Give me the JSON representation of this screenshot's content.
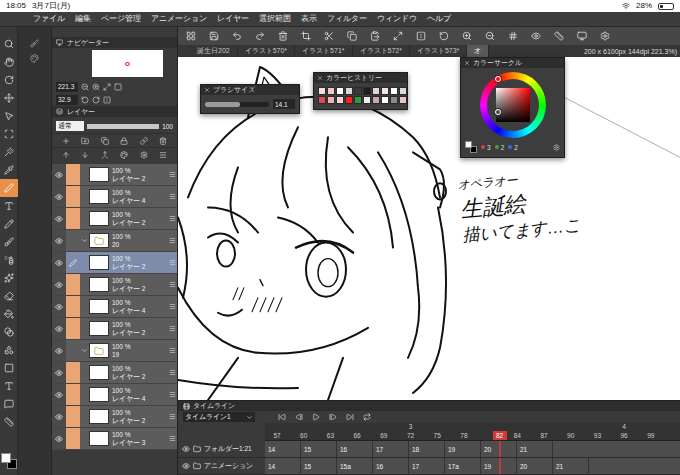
{
  "status_bar": {
    "time": "18:05",
    "date": "3月7日(月)",
    "battery": "28%",
    "battery_level": 0.28
  },
  "menu": [
    "ファイル",
    "編集",
    "ページ管理",
    "アニメーション",
    "レイヤー",
    "選択範囲",
    "表示",
    "フィルター",
    "ウィンドウ",
    "ヘルプ"
  ],
  "tools": [
    {
      "selected": false
    },
    {
      "selected": false
    },
    {
      "selected": false
    },
    {
      "selected": false
    },
    {
      "selected": false
    },
    {
      "selected": false
    },
    {
      "selected": false
    },
    {
      "selected": false
    },
    {
      "selected": true
    },
    {
      "selected": false
    },
    {
      "selected": false
    },
    {
      "selected": false
    },
    {
      "selected": false
    },
    {
      "selected": false
    },
    {
      "selected": false
    },
    {
      "selected": false
    },
    {
      "selected": false
    },
    {
      "selected": false
    },
    {
      "selected": false
    },
    {
      "selected": false
    },
    {
      "selected": false
    },
    {
      "selected": false
    }
  ],
  "colors": {
    "main": "#ffffff",
    "sub": "#000000"
  },
  "navigator": {
    "title": "ナビゲーター",
    "zoom": "221.3",
    "rotation": "32.9"
  },
  "layer_panel": {
    "title": "レイヤー",
    "blend_mode": "通常",
    "opacity": "100",
    "opacity_level": 1.0,
    "layers": [
      {
        "kind": "layer",
        "opacity": "100 %",
        "name": "レイヤー 2",
        "visible": true,
        "marked": true,
        "selected": false
      },
      {
        "kind": "layer",
        "opacity": "100 %",
        "name": "レイヤー 4",
        "visible": true,
        "marked": true,
        "selected": false
      },
      {
        "kind": "layer",
        "opacity": "100 %",
        "name": "レイヤー 2",
        "visible": true,
        "marked": true,
        "selected": false
      },
      {
        "kind": "folder",
        "opacity": "100 %",
        "name": "20",
        "visible": true,
        "marked": false,
        "selected": false,
        "expanded": true
      },
      {
        "kind": "layer",
        "opacity": "100 %",
        "name": "レイヤー 2",
        "visible": true,
        "marked": false,
        "selected": true
      },
      {
        "kind": "layer",
        "opacity": "100 %",
        "name": "レイヤー 2",
        "visible": true,
        "marked": true,
        "selected": false
      },
      {
        "kind": "layer",
        "opacity": "100 %",
        "name": "レイヤー 4",
        "visible": true,
        "marked": true,
        "selected": false
      },
      {
        "kind": "layer",
        "opacity": "100 %",
        "name": "レイヤー 2",
        "visible": true,
        "marked": true,
        "selected": false
      },
      {
        "kind": "folder",
        "opacity": "100 %",
        "name": "19",
        "visible": true,
        "marked": false,
        "selected": false,
        "expanded": true
      },
      {
        "kind": "layer",
        "opacity": "100 %",
        "name": "レイヤー 2",
        "visible": true,
        "marked": true,
        "selected": false
      },
      {
        "kind": "layer",
        "opacity": "100 %",
        "name": "レイヤー 4",
        "visible": true,
        "marked": true,
        "selected": false
      },
      {
        "kind": "layer",
        "opacity": "100 %",
        "name": "レイヤー 2",
        "visible": true,
        "marked": true,
        "selected": false
      },
      {
        "kind": "layer",
        "opacity": "100 %",
        "name": "レイヤー 3",
        "visible": true,
        "marked": true,
        "selected": false
      }
    ]
  },
  "document_tabs": [
    {
      "label": "誕生日202",
      "selected": false
    },
    {
      "label": "イラスト570*",
      "selected": false
    },
    {
      "label": "イラスト571*",
      "selected": false
    },
    {
      "label": "イラスト572*",
      "selected": false
    },
    {
      "label": "イラスト573*",
      "selected": false
    },
    {
      "label": "オ",
      "selected": true
    }
  ],
  "canvas_info": "200 x 6100px 144dpi 221.3%)",
  "canvas_note": [
    "オペラオー",
    "生誕絵",
    "描いてます…こ"
  ],
  "brush_size": {
    "title": "ブラシサイズ",
    "value": "14.1",
    "level": 0.55
  },
  "color_history": {
    "title": "カラーヒストリー",
    "swatches": [
      {
        "color": "#f6dede"
      },
      {
        "color": "#f1c6ca"
      },
      {
        "color": "#ffffff"
      },
      {
        "color": "#d9d9d9"
      },
      {
        "color": "#3a3a3a"
      },
      {
        "color": "#1e1e1e"
      },
      {
        "color": "#e6d2d2"
      },
      {
        "color": "#f4e3e3"
      },
      {
        "color": "#ffffff"
      },
      {
        "color": "#dcdcdc"
      },
      {
        "color": "#e24848"
      },
      {
        "color": "#f3b3b3"
      },
      {
        "color": "#f8d8d8"
      },
      {
        "color": "#ff2020"
      },
      {
        "color": "#2f9a3a"
      },
      {
        "color": "#f0f0f0"
      },
      {
        "color": "#c9a9a9"
      },
      {
        "color": "#ffffff"
      },
      {
        "color": "#8a8a8a"
      },
      {
        "color": "#e8c4c4"
      }
    ]
  },
  "color_circle": {
    "title": "カラーサークル",
    "hue_level": 0.0,
    "saturation": 0.08,
    "brightness": 0.3,
    "readings": [
      {
        "label": "3",
        "color": "#e04040"
      },
      {
        "label": "2",
        "color": "#3fa34a"
      },
      {
        "label": "2",
        "color": "#4466e0"
      }
    ]
  },
  "timeline": {
    "title": "タイムライン",
    "name": "タイムライン1",
    "seconds": [
      {
        "label": "3"
      },
      {
        "label": "4"
      }
    ],
    "frames": [
      {
        "label": "57",
        "selected": false
      },
      {
        "label": "60",
        "selected": false
      },
      {
        "label": "63",
        "selected": false
      },
      {
        "label": "66",
        "selected": false
      },
      {
        "label": "69",
        "selected": false
      },
      {
        "label": "72",
        "selected": false
      },
      {
        "label": "75",
        "selected": false
      },
      {
        "label": "78",
        "selected": false
      },
      {
        "label": "82",
        "selected": true
      },
      {
        "label": "84",
        "selected": false
      },
      {
        "label": "87",
        "selected": false
      },
      {
        "label": "90",
        "selected": false
      },
      {
        "label": "93",
        "selected": false
      },
      {
        "label": "96",
        "selected": false
      },
      {
        "label": "99",
        "selected": false
      }
    ],
    "tracks": [
      {
        "name": "フォルダー1:21",
        "visible": true,
        "cells": [
          "14",
          "15",
          "16",
          "17",
          "18",
          "19",
          "20",
          "21"
        ]
      },
      {
        "name": "アニメーション",
        "visible": true,
        "cells": [
          "14",
          "15",
          "15a",
          "16",
          "17",
          "17a",
          "19",
          "20",
          "21"
        ]
      }
    ]
  }
}
